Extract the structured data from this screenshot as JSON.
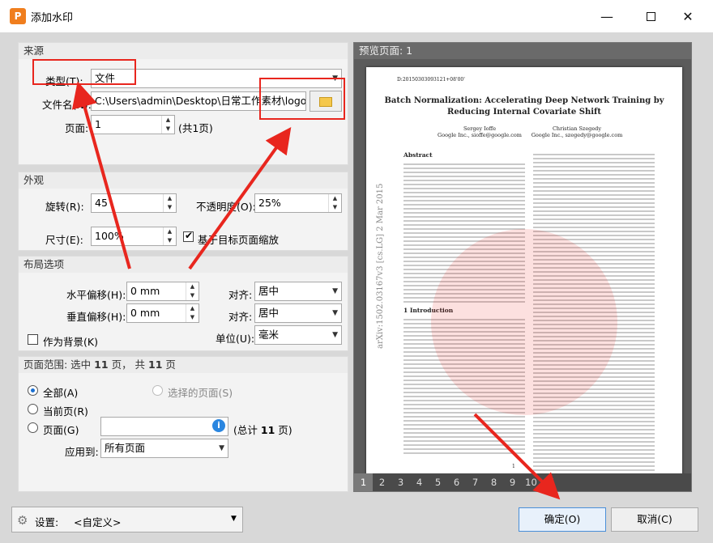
{
  "window": {
    "title": "添加水印"
  },
  "source": {
    "header": "来源",
    "type_label": "类型(T):",
    "type_value": "文件",
    "file_label": "文件名(N):",
    "file_value": "C:\\Users\\admin\\Desktop\\日常工作素材\\logo.j",
    "page_label": "页面:",
    "page_value": "1",
    "page_total": "(共1页)"
  },
  "appearance": {
    "header": "外观",
    "rotation_label": "旋转(R):",
    "rotation_value": "45",
    "opacity_label": "不透明度(O):",
    "opacity_value": "25%",
    "size_label": "尺寸(E):",
    "size_value": "100%",
    "scale_label": "基于目标页面缩放",
    "scale_checked": true
  },
  "layout": {
    "header": "布局选项",
    "h_offset_label": "水平偏移(H):",
    "h_offset_value": "0 mm",
    "v_offset_label": "垂直偏移(H):",
    "v_offset_value": "0 mm",
    "align_label": "对齐:",
    "align_h_value": "居中",
    "align_v_value": "居中",
    "unit_label": "单位(U):",
    "unit_value": "毫米",
    "background_label": "作为背景(K)"
  },
  "page_range": {
    "header_prefix": "页面范围: 选中",
    "selected_count": "11",
    "header_mid": "页， 共",
    "total_count": "11",
    "header_suffix": "页",
    "all_pages": "全部(A)",
    "selected_pages": "选择的页面(S)",
    "current_page": "当前页(R)",
    "pages": "页面(G)",
    "total_prefix": "(总计",
    "total_count2": "11",
    "total_suffix": "页)",
    "apply_label": "应用到:",
    "apply_value": "所有页面"
  },
  "preview": {
    "title": "预览页面: 1",
    "page_numbers": [
      "1",
      "2",
      "3",
      "4",
      "5",
      "6",
      "7",
      "8",
      "9",
      "10",
      "11"
    ],
    "doc": {
      "id": "D:20150303093121+08'00'",
      "title1": "Batch Normalization: Accelerating Deep Network Training by",
      "title2": "Reducing Internal Covariate Shift",
      "author1": "Sergey Ioffe",
      "author1_aff": "Google Inc., sioffe@google.com",
      "author2": "Christian Szegedy",
      "author2_aff": "Google Inc., szegedy@google.com",
      "abstract": "Abstract",
      "intro": "1   Introduction",
      "arxiv": "arXiv:1502.03167v3  [cs.LG]  2 Mar 2015",
      "page_num": "1"
    }
  },
  "footer": {
    "settings_label": "设置:",
    "settings_value": "<自定义>",
    "ok": "确定(O)",
    "cancel": "取消(C)"
  },
  "colors": {
    "accent": "#e8261e",
    "brand": "#f07e1e",
    "link": "#1a6fd1"
  }
}
